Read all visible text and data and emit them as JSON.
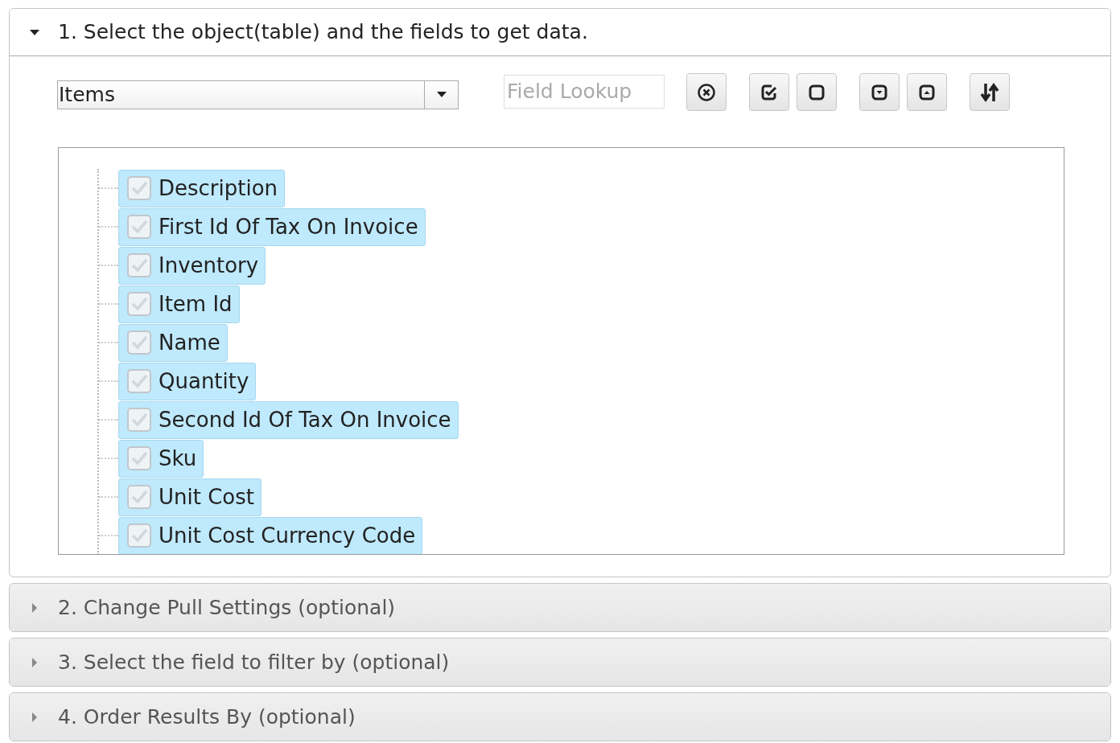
{
  "sections": [
    {
      "title": "1. Select the object(table) and the fields to get data.",
      "expanded": true,
      "object_select": {
        "value": "Items"
      },
      "field_lookup": {
        "placeholder": "Field Lookup"
      },
      "toolbar_groups": [
        [
          {
            "kind": "clear"
          }
        ],
        [
          {
            "kind": "check-all"
          },
          {
            "kind": "uncheck-all"
          }
        ],
        [
          {
            "kind": "expand"
          },
          {
            "kind": "collapse"
          }
        ],
        [
          {
            "kind": "sort"
          }
        ]
      ],
      "fields": [
        {
          "label": "Description",
          "checked": true,
          "selected": true
        },
        {
          "label": "First Id Of Tax On Invoice",
          "checked": true,
          "selected": true
        },
        {
          "label": "Inventory",
          "checked": true,
          "selected": true
        },
        {
          "label": "Item Id",
          "checked": true,
          "selected": true
        },
        {
          "label": "Name",
          "checked": true,
          "selected": true
        },
        {
          "label": "Quantity",
          "checked": true,
          "selected": true
        },
        {
          "label": "Second Id Of Tax On Invoice",
          "checked": true,
          "selected": true
        },
        {
          "label": "Sku",
          "checked": true,
          "selected": true
        },
        {
          "label": "Unit Cost",
          "checked": true,
          "selected": true
        },
        {
          "label": "Unit Cost Currency Code",
          "checked": true,
          "selected": true
        }
      ]
    },
    {
      "title": "2. Change Pull Settings (optional)",
      "expanded": false
    },
    {
      "title": "3. Select the field to filter by (optional)",
      "expanded": false
    },
    {
      "title": "4. Order Results By (optional)",
      "expanded": false
    }
  ]
}
